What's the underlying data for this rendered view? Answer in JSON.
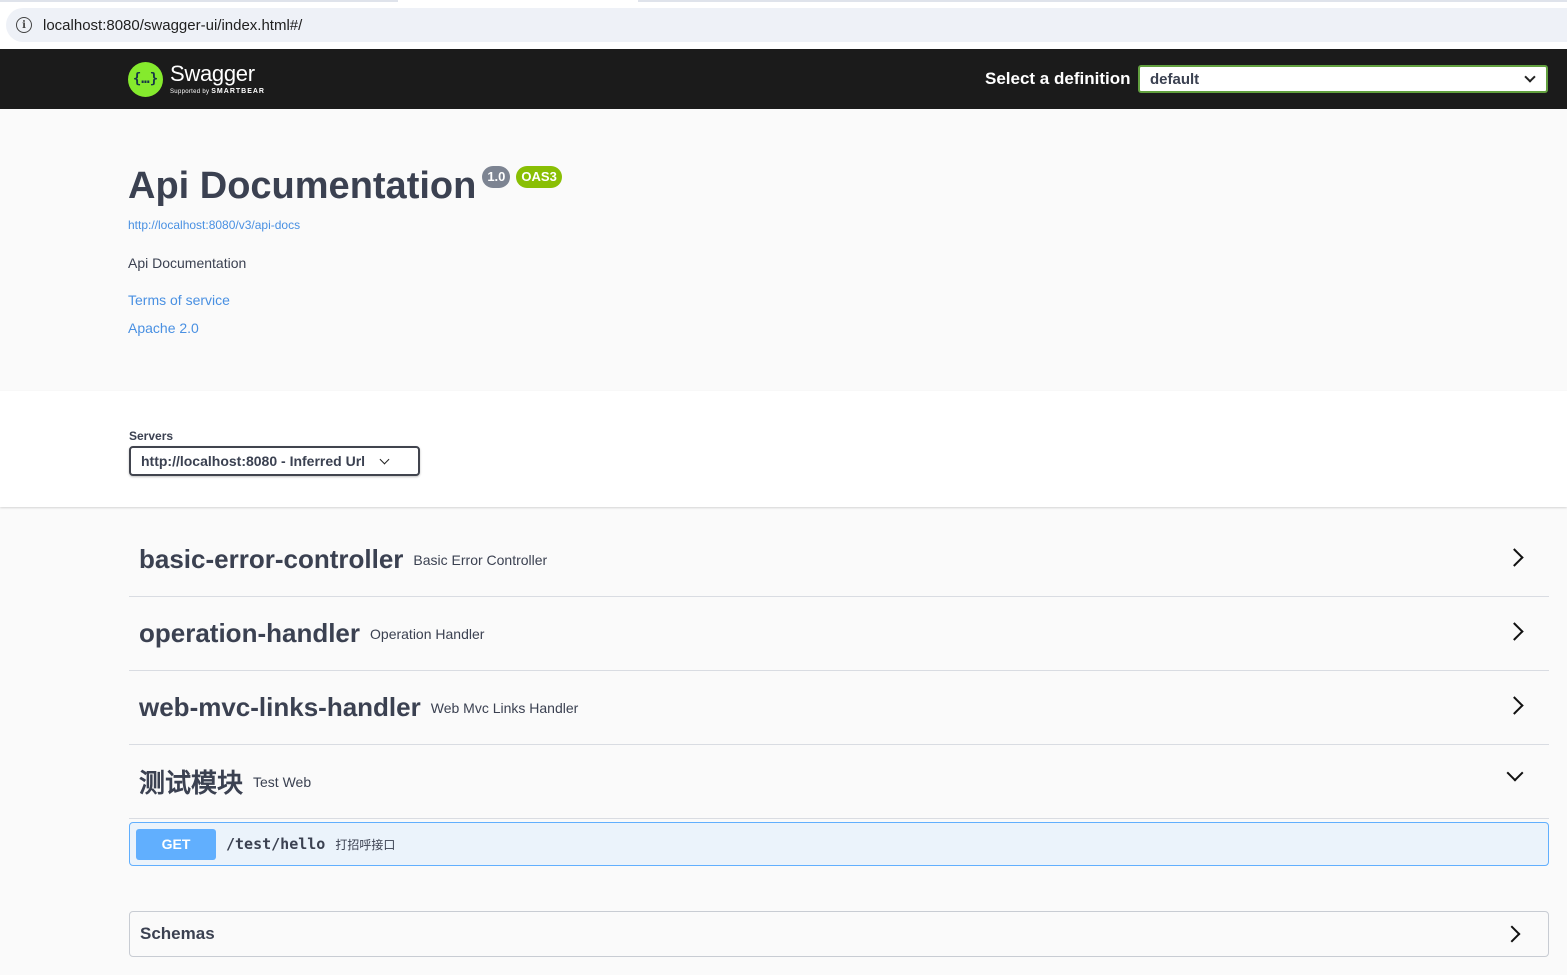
{
  "browser": {
    "url": "localhost:8080/swagger-ui/index.html#/"
  },
  "topbar": {
    "logo_glyph": "{…}",
    "logo_title": "Swagger",
    "logo_sub_prefix": "Supported by",
    "logo_sub_brand": "SMARTBEAR",
    "definition_label": "Select a definition",
    "definition_value": "default"
  },
  "info": {
    "title": "Api Documentation",
    "version_badge": "1.0",
    "spec_badge": "OAS3",
    "docs_url": "http://localhost:8080/v3/api-docs",
    "description": "Api Documentation",
    "terms_link": "Terms of service",
    "license_link": "Apache 2.0"
  },
  "servers": {
    "label": "Servers",
    "selected": "http://localhost:8080 - Inferred Url"
  },
  "tags": [
    {
      "name": "basic-error-controller",
      "description": "Basic Error Controller",
      "expanded": false
    },
    {
      "name": "operation-handler",
      "description": "Operation Handler",
      "expanded": false
    },
    {
      "name": "web-mvc-links-handler",
      "description": "Web Mvc Links Handler",
      "expanded": false
    },
    {
      "name": "测试模块",
      "description": "Test Web",
      "expanded": true
    }
  ],
  "operation": {
    "method": "GET",
    "path": "/test/hello",
    "summary": "打招呼接口"
  },
  "schemas": {
    "title": "Schemas"
  },
  "colors": {
    "topbar_bg": "#1b1b1b",
    "accent_green": "#85ea2d",
    "select_border": "#62a03f",
    "link_blue": "#4990e2",
    "get_blue": "#61affe",
    "oas_badge": "#89bf04",
    "version_badge": "#7d8492"
  },
  "icons": {
    "address_bar": "info-icon",
    "dropdowns": "chevron-down-icon",
    "collapsed_tags": "chevron-right-icon",
    "expanded_tag": "chevron-down-icon"
  }
}
